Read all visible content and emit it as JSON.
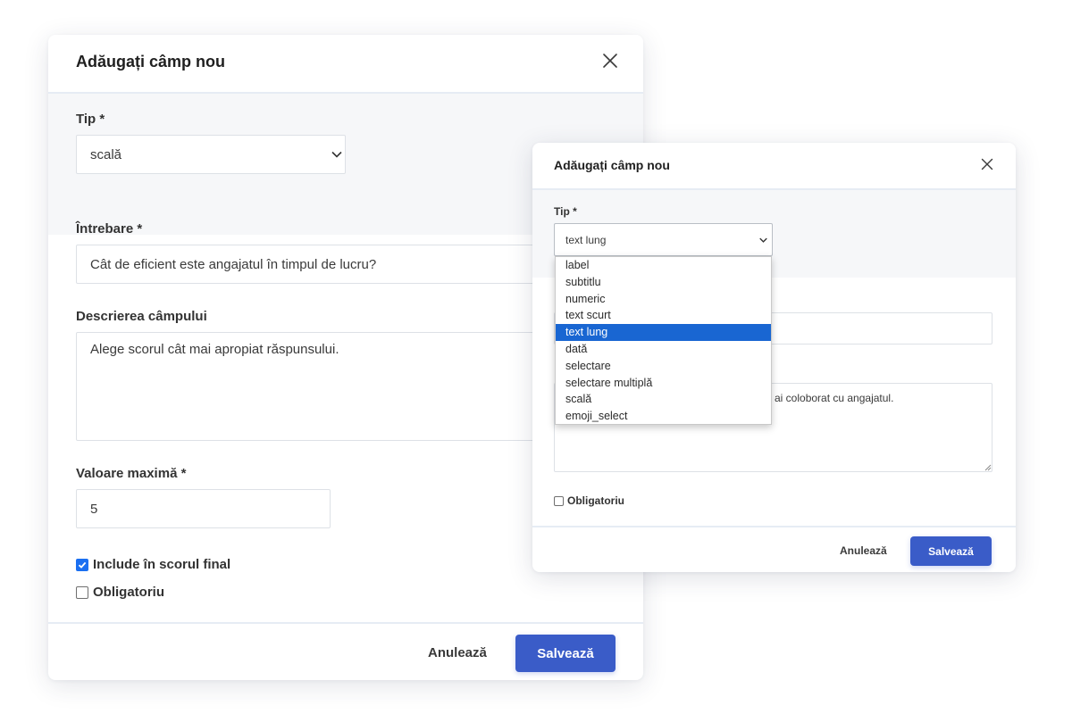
{
  "large_modal": {
    "title": "Adăugați câmp nou",
    "type_label": "Tip *",
    "type_value": "scală",
    "question_label": "Întrebare *",
    "question_value": "Cât de eficient este angajatul în timpul de lucru?",
    "description_label": "Descrierea câmpului",
    "description_value": "Alege scorul cât mai apropiat răspunsului.",
    "max_value_label": "Valoare maximă *",
    "max_value": "5",
    "include_in_score_label": "Include în scorul final",
    "include_in_score_checked": true,
    "required_label": "Obligatoriu",
    "required_checked": false,
    "cancel_label": "Anulează",
    "save_label": "Salvează"
  },
  "small_modal": {
    "title": "Adăugați câmp nou",
    "type_label": "Tip *",
    "type_value": "text lung",
    "description_value_visible": "ai coloborat cu angajatul.",
    "required_label": "Obligatoriu",
    "required_checked": false,
    "cancel_label": "Anulează",
    "save_label": "Salvează",
    "dropdown_options": [
      "label",
      "subtitlu",
      "numeric",
      "text scurt",
      "text lung",
      "dată",
      "selectare",
      "selectare multiplă",
      "scală",
      "emoji_select"
    ],
    "dropdown_selected": "text lung"
  },
  "colors": {
    "primary_button": "#3a5cc8",
    "checkbox_checked": "#1a6ff1",
    "option_highlight": "#1966d2",
    "section_background": "#f6f7f9",
    "divider": "#e6ecf4"
  },
  "icons": {
    "close": "close-icon",
    "select_arrow": "chevron-down-icon",
    "checkmark": "checkmark-icon"
  }
}
